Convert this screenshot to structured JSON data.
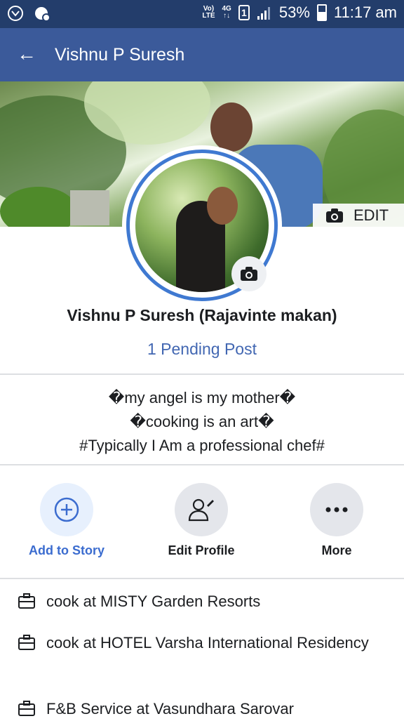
{
  "status_bar": {
    "network_label_top": "Vo)",
    "network_label_bottom": "LTE",
    "data_label_top": "4G",
    "data_label_bottom": "↑↓",
    "sim_number": "1",
    "battery": "53%",
    "battery_level": 0.53,
    "time": "11:17 am"
  },
  "navbar": {
    "back_icon": "arrow-left-icon",
    "title": "Vishnu P Suresh"
  },
  "cover": {
    "edit_label": "EDIT"
  },
  "profile": {
    "name": "Vishnu P Suresh (Rajavinte makan)",
    "pending": "1 Pending Post"
  },
  "bio": {
    "lines": [
      "�my angel is my mother�",
      "�cooking is an art�",
      "#Typically  I Am a professional chef#"
    ]
  },
  "actions": [
    {
      "label": "Add to Story",
      "icon": "plus-circle-icon"
    },
    {
      "label": "Edit Profile",
      "icon": "edit-profile-icon"
    },
    {
      "label": "More",
      "icon": "more-dots-icon"
    }
  ],
  "work": [
    {
      "text": "cook at MISTY Garden Resorts",
      "icon": "briefcase-icon"
    },
    {
      "text": "cook at HOTEL Varsha International Residency",
      "icon": "briefcase-icon"
    },
    {
      "text": "F&B Service at Vasundhara Sarovar",
      "icon": "briefcase-icon"
    }
  ],
  "colors": {
    "status_bar": "#233d6b",
    "nav_bar": "#3b5a9a",
    "link_blue": "#4267b2",
    "ring_blue": "#3f79d1"
  }
}
